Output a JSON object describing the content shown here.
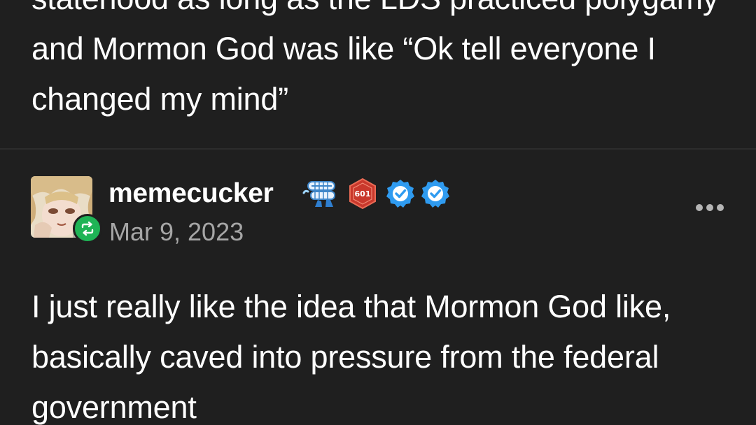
{
  "previous_post": {
    "text": "statehood as long as the LDS practiced polygamy and Mormon God was like “Ok tell everyone I changed my mind”"
  },
  "post": {
    "username": "memecucker",
    "badges": [
      {
        "icon": "chattering-teeth-badge-icon"
      },
      {
        "icon": "hex-badge-icon",
        "label": "601"
      },
      {
        "icon": "verified-check-icon"
      },
      {
        "icon": "verified-check-icon"
      }
    ],
    "date": "Mar 9, 2023",
    "body": "I just really like the idea that Mormon God like, basically caved into pressure from the federal government",
    "reblog_icon": "reblog-icon",
    "more_icon": "more-options-icon"
  },
  "colors": {
    "background": "#1f1f1f",
    "text": "#ffffff",
    "date": "#a6a6a6",
    "reblog_badge": "#1fb456",
    "verified": "#2f9bf0",
    "hex_badge": "#c9382c"
  }
}
